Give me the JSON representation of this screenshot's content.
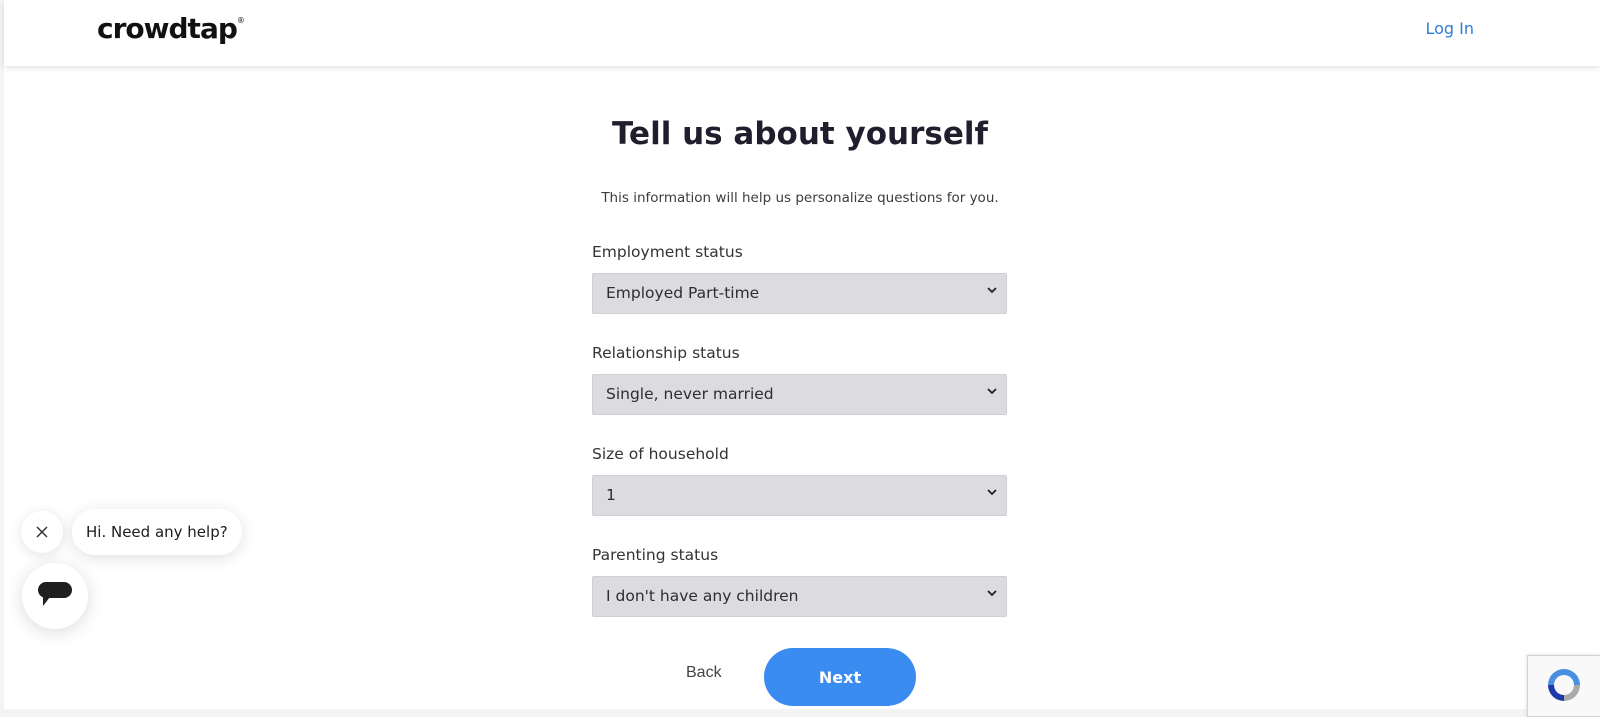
{
  "header": {
    "logo_text": "crowdtap",
    "logo_mark": "®",
    "login_label": "Log In"
  },
  "main": {
    "title": "Tell us about yourself",
    "subtitle": "This information will help us personalize questions for you.",
    "fields": [
      {
        "label": "Employment status",
        "value": "Employed Part-time"
      },
      {
        "label": "Relationship status",
        "value": "Single, never married"
      },
      {
        "label": "Size of household",
        "value": "1"
      },
      {
        "label": "Parenting status",
        "value": "I don't have any children"
      }
    ],
    "back_label": "Back",
    "next_label": "Next"
  },
  "chat": {
    "greeting": "Hi. Need any help?",
    "close_icon": "close-icon",
    "launcher_icon": "chat-icon"
  },
  "recaptcha": {
    "icon": "recaptcha-icon"
  },
  "colors": {
    "accent": "#3b8cf0",
    "link": "#2e7dd7",
    "select_bg": "#dcdce0"
  }
}
